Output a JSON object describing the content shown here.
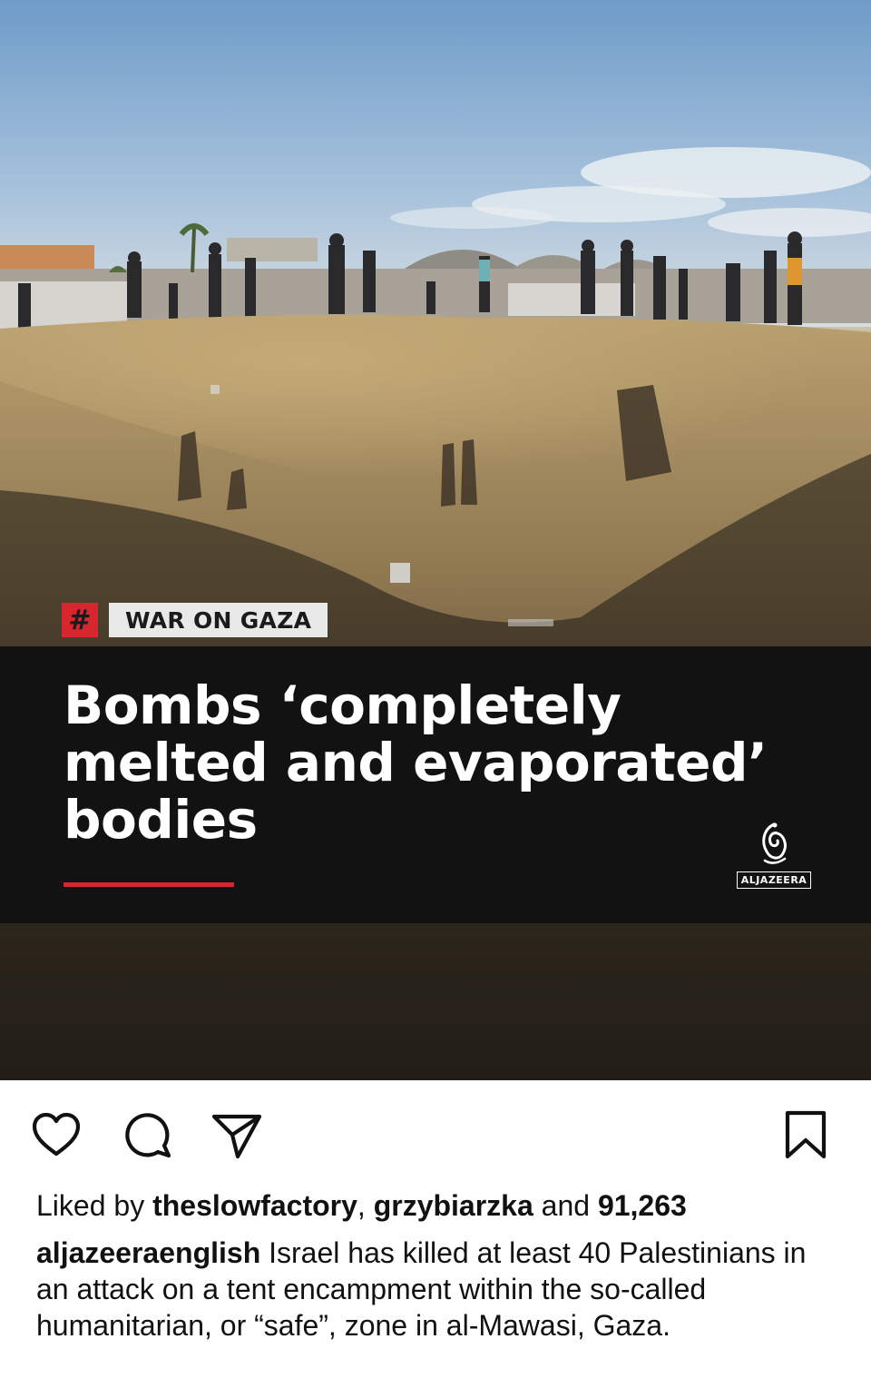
{
  "post": {
    "tag": {
      "symbol": "#",
      "label": "WAR ON GAZA"
    },
    "headline": {
      "lines": [
        "Bombs ‘completely",
        "melted and evaporated’",
        "bodies"
      ]
    },
    "brand": {
      "wordmark": "ALJAZEERA"
    },
    "colors": {
      "accent": "#d7262e",
      "panel": "#121212"
    }
  },
  "actions": {
    "like_icon": "heart-icon",
    "comment_icon": "comment-bubble-icon",
    "share_icon": "paper-plane-icon",
    "save_icon": "bookmark-icon"
  },
  "likes": {
    "prefix": "Liked by",
    "user1": "theslowfactory",
    "separator": ",",
    "user2": "grzybiarzka",
    "middle": "and",
    "count": "91,263"
  },
  "caption": {
    "username": "aljazeeraenglish",
    "text": "Israel has killed at least 40 Palestinians in an attack on a tent encampment within the so-called humanitarian, or “safe”, zone in al-Mawasi, Gaza."
  }
}
